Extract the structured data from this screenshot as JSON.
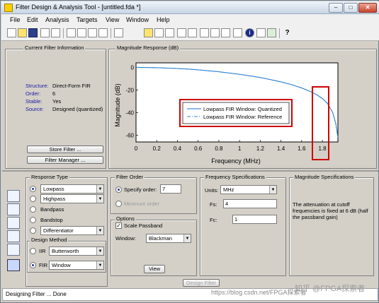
{
  "window": {
    "title": "Filter Design & Analysis Tool - [untitled.fda *]",
    "controls": {
      "minimize": "–",
      "maximize": "□",
      "close": "✕"
    }
  },
  "menu": [
    "File",
    "Edit",
    "Analysis",
    "Targets",
    "View",
    "Window",
    "Help"
  ],
  "toolbar": {
    "icons": [
      "new-icon",
      "open-icon",
      "save-icon",
      "print-icon",
      "print-preview-icon",
      "zoom-in-icon",
      "zoom-x-icon",
      "zoom-y-icon",
      "full-view-icon",
      "filter-specs-icon",
      "magnitude-icon",
      "phase-icon",
      "mag-phase-icon",
      "group-delay-icon",
      "phase-delay-icon",
      "impulse-icon",
      "step-icon",
      "pole-zero-icon",
      "coeffs-icon",
      "info-icon",
      "round-off-icon",
      "rounded-icon",
      "whats-this-icon"
    ],
    "info_glyph": "i",
    "help_glyph": "?"
  },
  "current_filter": {
    "title": "Current Filter Information",
    "rows": [
      {
        "label": "Structure:",
        "value": "Direct-Form FIR"
      },
      {
        "label": "Order:",
        "value": "6"
      },
      {
        "label": "Stable:",
        "value": "Yes"
      },
      {
        "label": "Source:",
        "value": "Designed (quantized)"
      }
    ],
    "store_button": "Store Filter ...",
    "manager_button": "Filter Manager ..."
  },
  "magnitude_panel": {
    "title": "Magnitude Response (dB)"
  },
  "chart_data": {
    "type": "line",
    "title": "",
    "xlabel": "Frequency (MHz)",
    "ylabel": "Magnitude (dB)",
    "xlim": [
      0,
      1.95
    ],
    "ylim": [
      -66,
      4
    ],
    "xticks": [
      0,
      0.2,
      0.4,
      0.6,
      0.8,
      1,
      1.2,
      1.4,
      1.6,
      1.8
    ],
    "xtick_labels": [
      "0",
      "0.2",
      "0.4",
      "0.6",
      "0.8",
      "1",
      "1.2",
      "1.4",
      "1.6",
      "1.8"
    ],
    "yticks": [
      0,
      -20,
      -40,
      -60
    ],
    "ytick_labels": [
      "0",
      "-20",
      "-40",
      "-60"
    ],
    "grid": false,
    "legend_position": "center",
    "colors": {
      "quantized": "#1f6fc8",
      "reference": "#2a8ad8",
      "highlight": "#d00000"
    },
    "series": [
      {
        "name": "Lowpass FIR Window: Quantized",
        "style": "solid",
        "x": [
          0,
          0.1,
          0.2,
          0.3,
          0.4,
          0.5,
          0.6,
          0.7,
          0.8,
          0.9,
          1.0,
          1.1,
          1.2,
          1.3,
          1.4,
          1.5,
          1.6,
          1.7,
          1.75,
          1.8,
          1.85,
          1.9,
          1.93,
          1.95
        ],
        "y": [
          0,
          -0.1,
          -0.3,
          -0.6,
          -1.0,
          -1.5,
          -2.2,
          -3.0,
          -3.9,
          -5.0,
          -6.2,
          -7.5,
          -9.0,
          -10.8,
          -12.8,
          -15.2,
          -18.2,
          -22.0,
          -24.5,
          -27.5,
          -32.0,
          -40.0,
          -50.0,
          -62.0
        ]
      },
      {
        "name": "Lowpass FIR Window: Reference",
        "style": "dash-dot",
        "x": [
          0,
          0.1,
          0.2,
          0.3,
          0.4,
          0.5,
          0.6,
          0.7,
          0.8,
          0.9,
          1.0,
          1.1,
          1.2,
          1.3,
          1.4,
          1.5,
          1.6,
          1.7,
          1.75,
          1.8,
          1.85,
          1.9,
          1.93,
          1.95
        ],
        "y": [
          0,
          -0.1,
          -0.3,
          -0.6,
          -1.0,
          -1.5,
          -2.2,
          -3.0,
          -3.9,
          -5.0,
          -6.2,
          -7.5,
          -9.0,
          -10.8,
          -12.8,
          -15.2,
          -18.2,
          -22.0,
          -24.5,
          -27.5,
          -32.0,
          -40.0,
          -50.0,
          -62.0
        ]
      }
    ]
  },
  "response_type": {
    "title": "Response Type",
    "options": [
      {
        "label": "Lowpass",
        "selected": true,
        "dropdown": true
      },
      {
        "label": "Highpass",
        "selected": false,
        "dropdown": true
      },
      {
        "label": "Bandpass",
        "selected": false,
        "dropdown": false
      },
      {
        "label": "Bandstop",
        "selected": false,
        "dropdown": false
      },
      {
        "label": "Differentiator",
        "selected": false,
        "dropdown": true
      }
    ]
  },
  "design_method": {
    "title": "Design Method",
    "iir_label": "IIR",
    "iir_value": "Butterworth",
    "fir_label": "FIR",
    "fir_value": "Window"
  },
  "filter_order": {
    "title": "Filter Order",
    "specify_label": "Specify order:",
    "specify_value": "7",
    "minimum_label": "Minimum order"
  },
  "options": {
    "title": "Options",
    "scale_passband_label": "Scale Passband",
    "window_label": "Window:",
    "window_value": "Blackman",
    "view_button": "View"
  },
  "freq_specs": {
    "title": "Frequency Specifications",
    "units_label": "Units:",
    "units_value": "MHz",
    "fs_label": "Fs:",
    "fs_value": "4",
    "fc_label": "Fc:",
    "fc_value": "1"
  },
  "mag_specs": {
    "title": "Magnitude Specifications",
    "note": "The attenuation at cutoff frequencies is fixed at 6 dB (half the passband gain)"
  },
  "design_button": "Design Filter",
  "status": "Designing Filter ... Done",
  "watermark": "https://blog.csdn.net/FPGA探索者",
  "watermark_brand": "知乎 @FPGA探索者",
  "dropdown_arrow": "▼",
  "check_mark": "✓"
}
